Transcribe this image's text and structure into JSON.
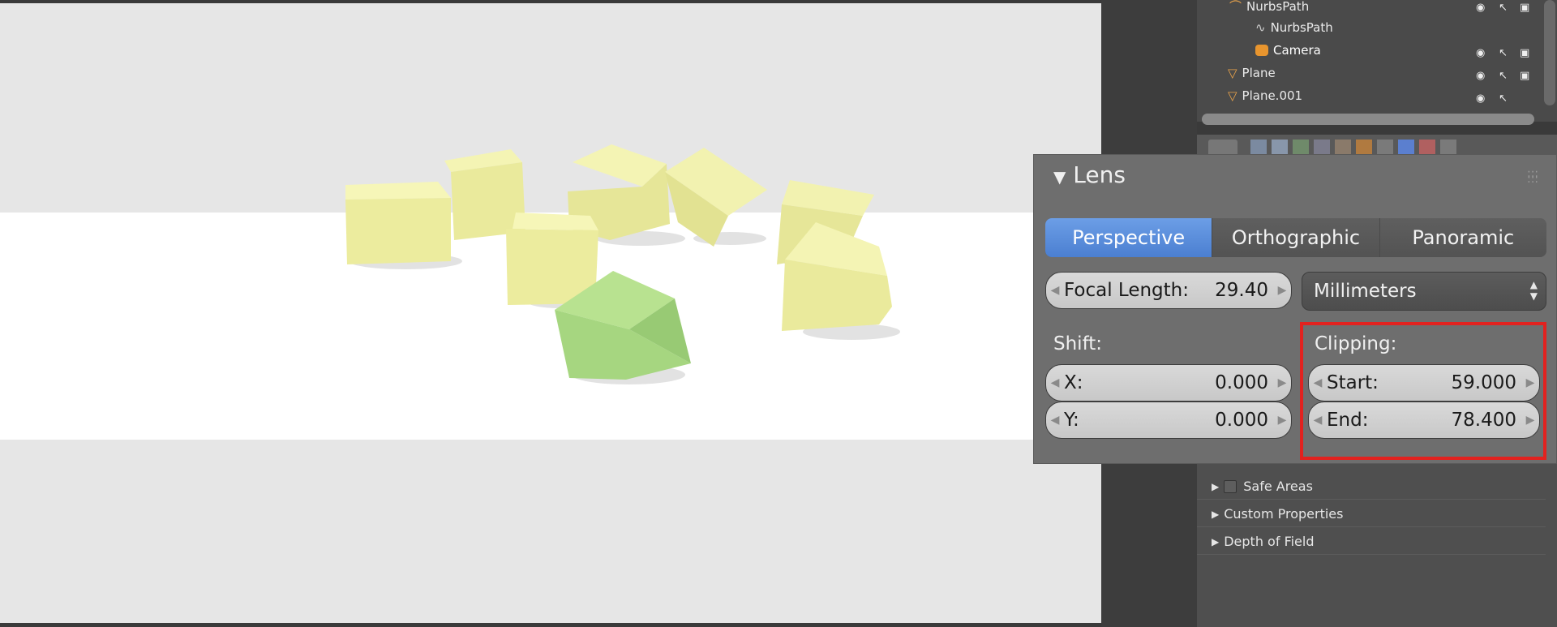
{
  "outliner": {
    "rows": [
      {
        "label": "NurbsPath",
        "indent": 1
      },
      {
        "label": "NurbsPath",
        "indent": 2
      },
      {
        "label": "Camera",
        "indent": 2
      },
      {
        "label": "Plane",
        "indent": 1
      },
      {
        "label": "Plane.001",
        "indent": 1
      }
    ]
  },
  "lens": {
    "title": "Lens",
    "projection": {
      "perspective": "Perspective",
      "orthographic": "Orthographic",
      "panoramic": "Panoramic",
      "selected": "Perspective"
    },
    "focal_length": {
      "label": "Focal Length:",
      "value": "29.40"
    },
    "unit": "Millimeters",
    "shift": {
      "label": "Shift:",
      "x_label": "X:",
      "x_value": "0.000",
      "y_label": "Y:",
      "y_value": "0.000"
    },
    "clipping": {
      "label": "Clipping:",
      "start_label": "Start:",
      "start_value": "59.000",
      "end_label": "End:",
      "end_value": "78.400"
    }
  },
  "panels": {
    "safe_areas": "Safe Areas",
    "custom_properties": "Custom Properties",
    "depth_of_field": "Depth of Field"
  },
  "colors": {
    "accent_blue": "#4b7fd1",
    "highlight_red": "#e2221f",
    "cube_yellow": "#eef0a0",
    "cube_green": "#a9d884"
  }
}
